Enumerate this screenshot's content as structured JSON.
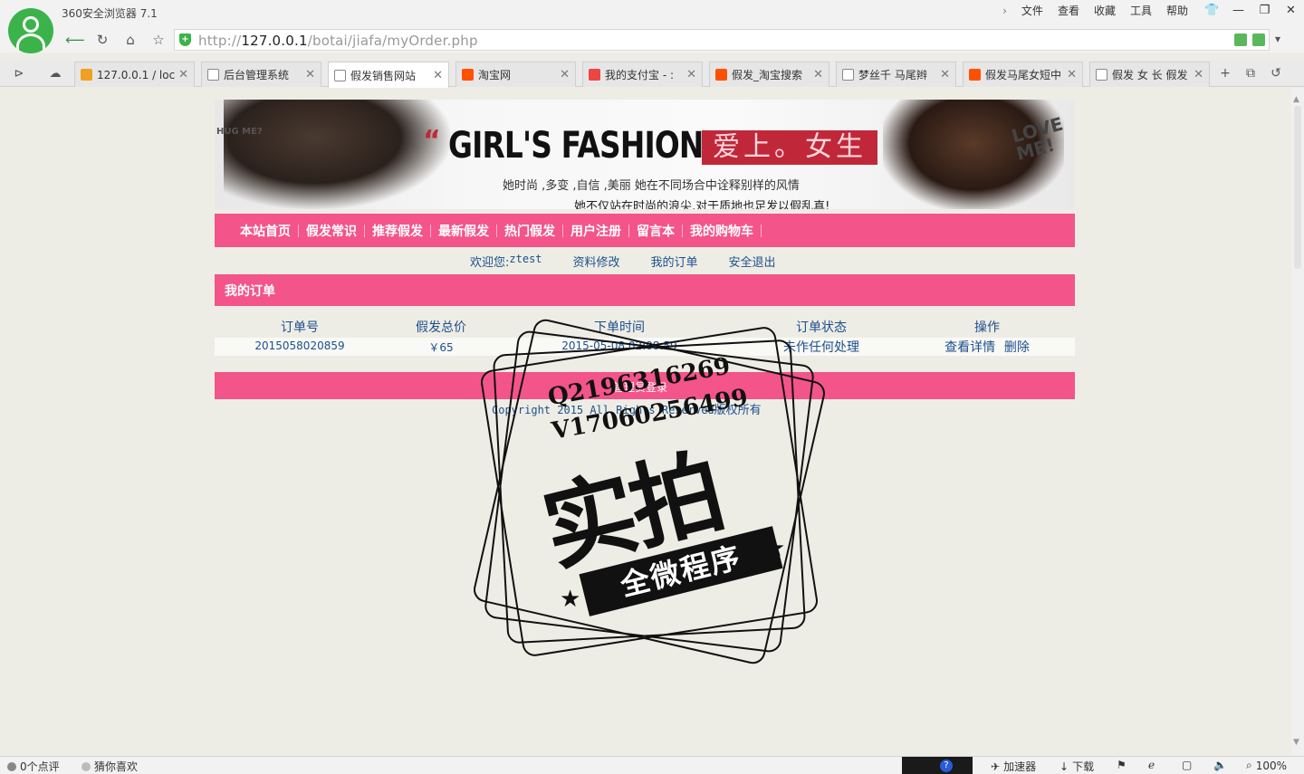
{
  "browser": {
    "app_title": "360安全浏览器 7.1",
    "menu": [
      "文件",
      "查看",
      "收藏",
      "工具",
      "帮助"
    ],
    "url_prefix": "http://",
    "url_host": "127.0.0.1",
    "url_path": "/botai/jiafa/myOrder.php",
    "tabs": [
      {
        "label": "127.0.0.1 / loc",
        "icon": "pma-icon"
      },
      {
        "label": "后台管理系统",
        "icon": "page-icon"
      },
      {
        "label": "假发销售网站",
        "icon": "page-icon",
        "active": true
      },
      {
        "label": "淘宝网",
        "icon": "taobao-icon"
      },
      {
        "label": "我的支付宝 - :",
        "icon": "alipay-icon"
      },
      {
        "label": "假发_淘宝搜索",
        "icon": "taobao-icon"
      },
      {
        "label": "梦丝千 马尾辫",
        "icon": "page-icon"
      },
      {
        "label": "假发马尾女短中",
        "icon": "taobao-icon"
      },
      {
        "label": "假发 女 长 假发",
        "icon": "page-icon"
      }
    ]
  },
  "banner": {
    "brand": "GIRL'S FASHION",
    "brand_cn": "爱上。女生",
    "line1": "她时尚  ,多变  ,自信  ,美丽   她在不同场合中诠释别样的风情",
    "line2": "她不仅站在时尚的浪尖,对于质地也足发以假乱真!",
    "love": "LOVE ME!",
    "hug": "HUG ME?"
  },
  "nav": [
    "本站首页",
    "假发常识",
    "推荐假发",
    "最新假发",
    "热门假发",
    "用户注册",
    "留言本",
    "我的购物车"
  ],
  "welcome": {
    "prefix": "欢迎您:",
    "user": "ztest",
    "links": [
      "资料修改",
      "我的订单",
      "安全退出"
    ]
  },
  "section_title": "我的订单",
  "orders": {
    "headers": [
      "订单号",
      "假发总价",
      "下单时间",
      "订单状态",
      "操作"
    ],
    "rows": [
      {
        "id": "2015058020859",
        "total": "￥65",
        "time": "2015-05-08 02:08:59",
        "status": "未作任何处理",
        "ops": [
          "查看详情",
          "删除"
        ]
      }
    ]
  },
  "footer": {
    "link": "管理员登录",
    "copyright": "Copyright 2015  All Rights Reserved",
    "copyright_cn": "版权所有"
  },
  "watermark": {
    "qq": "Q2196316269",
    "wx": "V17060256499",
    "big": "实拍",
    "ribbon": "全微程序"
  },
  "status": {
    "reviews": "0个点评",
    "guess": "猜你喜欢",
    "accelerate": "加速器",
    "download": "下载",
    "zoom": "100%"
  }
}
